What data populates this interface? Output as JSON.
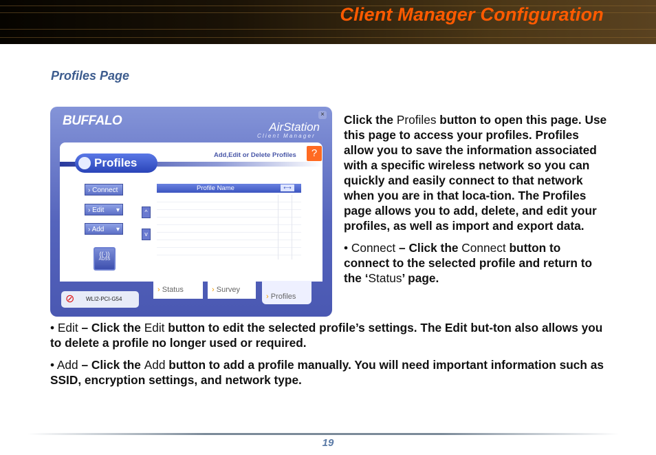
{
  "header": {
    "title": "Client Manager Configuration"
  },
  "page_subtitle": "Profiles Page",
  "paragraph_profiles": [
    {
      "text": "Click the ",
      "style": "bold"
    },
    {
      "text": "Profiles",
      "style": "plain"
    },
    {
      "text": " button to open this page. Use this page to access your profiles. Profiles allow you to save the information associated with a specific wireless network so you can quickly and easily connect to that network when you are in that loca-tion. The Profiles page allows you to add, delete, and edit your profiles, as well as import and export data.",
      "style": "bold"
    }
  ],
  "bullet_connect": {
    "marker": "• ",
    "name": "Connect",
    "dash": " – ",
    "lead": "Click the ",
    "button": "Connect",
    "text1": " button to connect to the selected profile and return to the ‘",
    "status": "Status",
    "text2": "’ page."
  },
  "bullet_edit": {
    "marker": "• ",
    "name": "Edit",
    "dash": " – ",
    "lead": "Click the ",
    "button": "Edit",
    "text": " button to edit the selected profile’s settings.  The Edit but-ton also allows you to delete a profile no longer used or required."
  },
  "bullet_add": {
    "marker": "• ",
    "name": "Add",
    "dash": " – ",
    "lead": "Click the ",
    "button": "Add",
    "text": " button to add a profile manually.  You will need important information such as SSID, encryption settings, and network type."
  },
  "screenshot": {
    "logo": "BUFFALO",
    "brand": "AirStation",
    "brand_sub": "Client Manager",
    "close_glyph": "×",
    "section_title": "Profiles",
    "hint": "Add,Edit or Delete Profiles",
    "help": "?",
    "buttons": {
      "connect": "Connect",
      "edit": "Edit",
      "add": "Add"
    },
    "button_prefix": "›",
    "dropdown_glyph": "▾",
    "up": "^",
    "down": "v",
    "aoss": "AOSS",
    "list_header": "Profile Name",
    "key_glyph": "⟷",
    "tabs": {
      "status": "Status",
      "survey": "Survey",
      "profiles": "Profiles"
    },
    "device": "WLI2-PCI-G54",
    "no_glyph": "⊘"
  },
  "page_number": "19"
}
